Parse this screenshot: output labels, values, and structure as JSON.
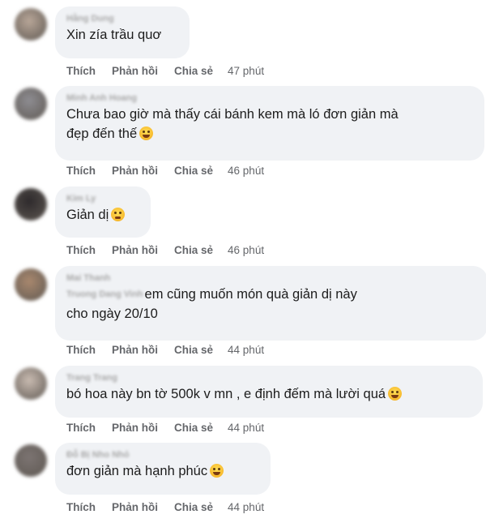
{
  "comments": [
    {
      "author": "Hằng Dung",
      "lines": [
        "Xin zía trầu quơ"
      ],
      "emoji": null,
      "actions": {
        "like": "Thích",
        "reply": "Phản hồi",
        "share": "Chia sẻ"
      },
      "time": "47 phút",
      "avatar_color": "#b8a698"
    },
    {
      "author": "Minh Anh Hoang",
      "lines": [
        "Chưa bao giờ mà thấy cái bánh kem mà ló đơn giản mà",
        "đẹp đến thế"
      ],
      "emoji": "grinning-face-icon",
      "actions": {
        "like": "Thích",
        "reply": "Phản hồi",
        "share": "Chia sẻ"
      },
      "time": "46 phút",
      "avatar_color": "#8e8d92"
    },
    {
      "author": "Kim Ly",
      "lines": [
        "Giản dị"
      ],
      "emoji": "sweat-face-icon",
      "actions": {
        "like": "Thích",
        "reply": "Phản hồi",
        "share": "Chia sẻ"
      },
      "time": "46 phút",
      "avatar_color": "#2e2a2c"
    },
    {
      "author": "Mai Thanh",
      "mention": "Truong Dang Vinh",
      "lines": [
        "em cũng muốn món quà giản dị này",
        "cho ngày 20/10"
      ],
      "emoji": null,
      "actions": {
        "like": "Thích",
        "reply": "Phản hồi",
        "share": "Chia sẻ"
      },
      "time": "44 phút",
      "avatar_color": "#a9886e"
    },
    {
      "author": "Trang Trang",
      "lines": [
        "bó hoa này bn tờ 500k v mn , e định đếm mà lười quá"
      ],
      "emoji": "rofl-face-icon",
      "actions": {
        "like": "Thích",
        "reply": "Phản hồi",
        "share": "Chia sẻ"
      },
      "time": "44 phút",
      "avatar_color": "#c9bbb1"
    },
    {
      "author": "Đỗ Bị Nho Nhỏ",
      "lines": [
        "đơn giản mà hạnh phúc"
      ],
      "emoji": "laughing-face-icon",
      "actions": {
        "like": "Thích",
        "reply": "Phản hồi",
        "share": "Chia sẻ"
      },
      "time": "44 phút",
      "avatar_color": "#7c7472"
    }
  ]
}
